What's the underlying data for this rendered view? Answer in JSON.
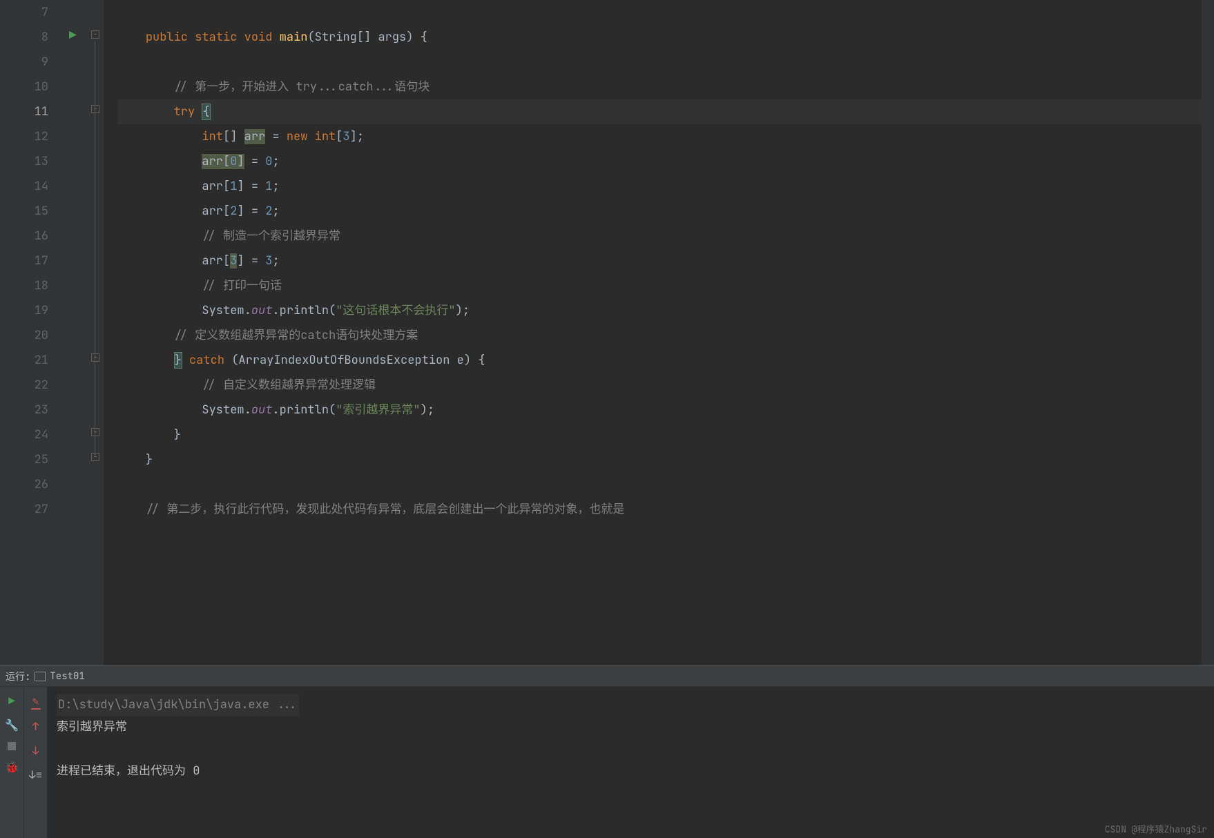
{
  "editor": {
    "lines": [
      {
        "num": "7",
        "current": false
      },
      {
        "num": "8",
        "current": false
      },
      {
        "num": "9",
        "current": false
      },
      {
        "num": "10",
        "current": false
      },
      {
        "num": "11",
        "current": true
      },
      {
        "num": "12",
        "current": false
      },
      {
        "num": "13",
        "current": false
      },
      {
        "num": "14",
        "current": false
      },
      {
        "num": "15",
        "current": false
      },
      {
        "num": "16",
        "current": false
      },
      {
        "num": "17",
        "current": false
      },
      {
        "num": "18",
        "current": false
      },
      {
        "num": "19",
        "current": false
      },
      {
        "num": "20",
        "current": false
      },
      {
        "num": "21",
        "current": false
      },
      {
        "num": "22",
        "current": false
      },
      {
        "num": "23",
        "current": false
      },
      {
        "num": "24",
        "current": false
      },
      {
        "num": "25",
        "current": false
      },
      {
        "num": "26",
        "current": false
      },
      {
        "num": "27",
        "current": false
      }
    ],
    "code": {
      "l8": {
        "kw1": "public",
        "kw2": "static",
        "kw3": "void",
        "fn": "main",
        "rest": "(String[] args) {"
      },
      "l10": {
        "cmt": "// 第一步，开始进入 try...catch...语句块"
      },
      "l11": {
        "kw": "try",
        "brace": "{"
      },
      "l12": {
        "kw1": "int",
        "br": "[]",
        "var": "arr",
        "eq": " = ",
        "kw2": "new int",
        "br2": "[",
        "num": "3",
        "br3": "];"
      },
      "l13": {
        "var": "arr",
        "br": "[",
        "num1": "0",
        "br2": "]",
        "eq": " = ",
        "num2": "0",
        "semi": ";"
      },
      "l14": {
        "var": "arr",
        "br": "[",
        "num1": "1",
        "br2": "]",
        "eq": " = ",
        "num2": "1",
        "semi": ";"
      },
      "l15": {
        "var": "arr",
        "br": "[",
        "num1": "2",
        "br2": "]",
        "eq": " = ",
        "num2": "2",
        "semi": ";"
      },
      "l16": {
        "cmt": "// 制造一个索引越界异常"
      },
      "l17": {
        "var": "arr",
        "br": "[",
        "num1": "3",
        "br2": "]",
        "eq": " = ",
        "num2": "3",
        "semi": ";"
      },
      "l18": {
        "cmt": "// 打印一句话"
      },
      "l19": {
        "cls": "System.",
        "fld": "out",
        "call": ".println(",
        "str": "\"这句话根本不会执行\"",
        "end": ");"
      },
      "l20": {
        "cmt": "// 定义数组越界异常的catch语句块处理方案"
      },
      "l21": {
        "brace": "}",
        "kw": "catch",
        "rest": " (ArrayIndexOutOfBoundsException e) {"
      },
      "l22": {
        "cmt": "// 自定义数组越界异常处理逻辑"
      },
      "l23": {
        "cls": "System.",
        "fld": "out",
        "call": ".println(",
        "str": "\"索引越界异常\"",
        "end": ");"
      },
      "l24": {
        "text": "}"
      },
      "l25": {
        "text": "}"
      },
      "l27": {
        "cmt": "// 第二步，执行此行代码，发现此处代码有异常，底层会创建出一个此异常的对象，也就是"
      }
    }
  },
  "run": {
    "header_label": "运行:",
    "config_name": "Test01",
    "console_cmd": "D:\\study\\Java\\jdk\\bin\\java.exe ...",
    "console_out1": "索引越界异常",
    "console_out2": "进程已结束，退出代码为 0"
  },
  "watermark": "CSDN @程序猿ZhangSir"
}
